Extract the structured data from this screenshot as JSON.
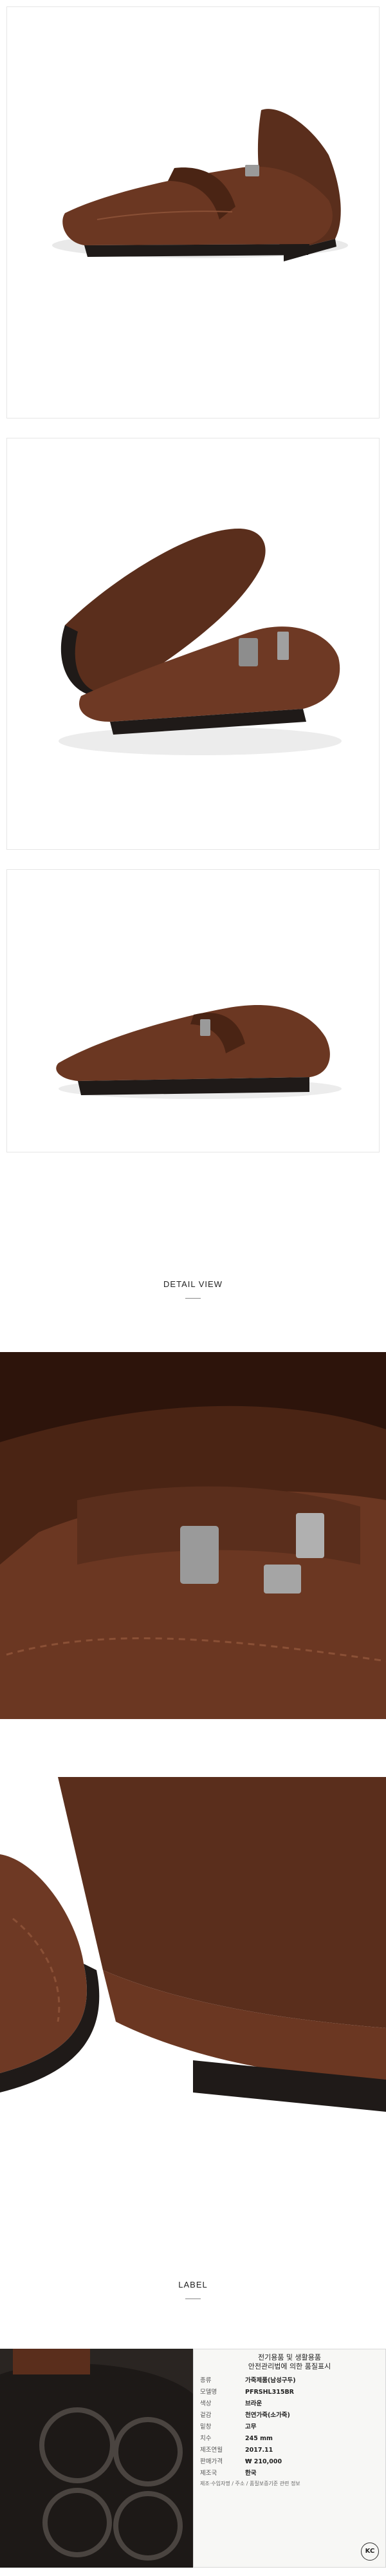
{
  "sections": {
    "detail_title": "DETAIL VIEW",
    "label_title": "LABEL"
  },
  "colors": {
    "leather": "#5a2e1c",
    "leather_light": "#7b432a",
    "sole": "#1f1a18"
  },
  "label": {
    "title_line1": "전기용품 및 생활용품",
    "title_line2": "안전관리법에 의한 품질표시",
    "rows": [
      {
        "k": "종류",
        "v": "가죽제품(남성구두)"
      },
      {
        "k": "모델명",
        "v": "PFRSHL315BR"
      },
      {
        "k": "색상",
        "v": "브라운"
      },
      {
        "k": "겉감",
        "v": "천연가죽(소가죽)"
      },
      {
        "k": "밑창",
        "v": "고무"
      },
      {
        "k": "치수",
        "v": "245 mm"
      },
      {
        "k": "제조연월",
        "v": "2017.11"
      },
      {
        "k": "판매가격",
        "v": "₩ 210,000"
      },
      {
        "k": "제조국",
        "v": "한국"
      }
    ],
    "foot": "제조·수입자명 / 주소 / 품질보증기준 관련 정보",
    "kc": "KC"
  }
}
